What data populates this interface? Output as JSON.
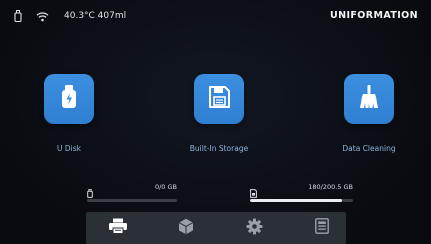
{
  "status_bar": {
    "temperature_resin": "40.3°C 407ml",
    "brand": "UNIFORMATION",
    "icons": [
      "usb-stick-icon",
      "wifi-icon"
    ]
  },
  "tiles": [
    {
      "label": "U Disk",
      "icon": "usb-drive-icon"
    },
    {
      "label": "Built-In Storage",
      "icon": "floppy-disk-icon"
    },
    {
      "label": "Data Cleaning",
      "icon": "broom-icon"
    }
  ],
  "storage": {
    "usb": {
      "icon": "usb-stick-icon",
      "value": "0/0 GB",
      "used_fraction": 0
    },
    "internal": {
      "icon": "sd-card-icon",
      "value": "180/200.5 GB",
      "used_fraction": 0.898
    }
  },
  "nav": {
    "items": [
      {
        "icon": "printer-icon",
        "active": true
      },
      {
        "icon": "cube-icon",
        "active": false
      },
      {
        "icon": "gear-icon",
        "active": false
      },
      {
        "icon": "info-panel-icon",
        "active": false
      }
    ]
  },
  "colors": {
    "tile_blue": "#3a8bdd",
    "background": "#0b0e14",
    "nav_bar": "#2b2f36",
    "label_blue": "#8fb4dc"
  }
}
